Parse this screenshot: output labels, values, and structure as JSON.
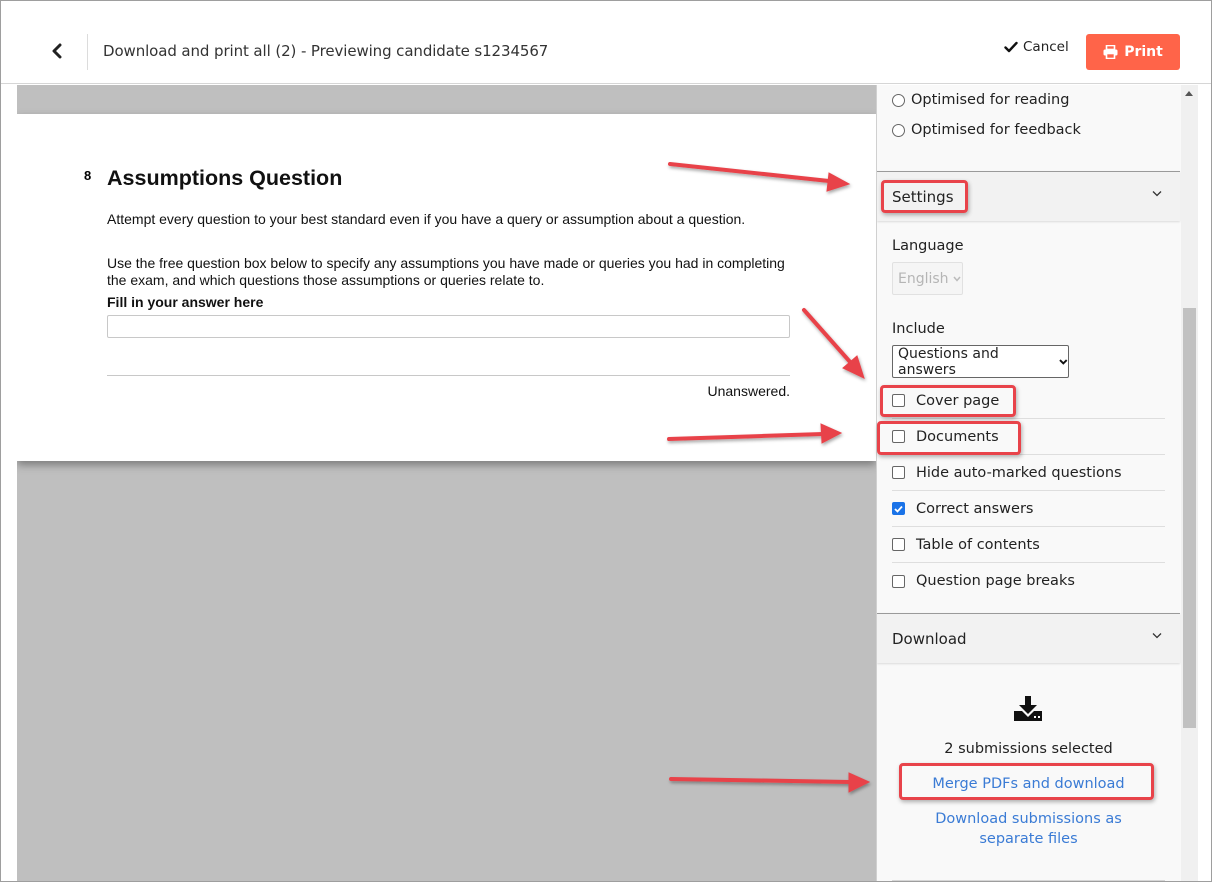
{
  "header": {
    "title": "Download and print all (2) - Previewing candidate s1234567",
    "back_icon": "chevron-left-icon",
    "cancel_label": "Cancel",
    "cancel_icon": "checkmark-icon",
    "print_label": "Print",
    "print_icon": "printer-icon",
    "print_color": "#ff6449"
  },
  "preview": {
    "question_number": "8",
    "question_title": "Assumptions Question",
    "paragraph_1": "Attempt every question to your best standard even if you have a query or assumption about a question.",
    "paragraph_2": "Use the free question box below to specify any assumptions you have made or queries you had in completing the exam, and which questions those assumptions or queries relate to.",
    "answer_label": "Fill in your answer here",
    "answer_value": "",
    "status": "Unanswered."
  },
  "sidebar": {
    "layout_options": [
      {
        "label": "Optimised for reading",
        "selected": false
      },
      {
        "label": "Optimised for feedback",
        "selected": false
      }
    ],
    "settings": {
      "header": "Settings",
      "language_label": "Language",
      "language_value": "English",
      "include_label": "Include",
      "include_value": "Questions and answers",
      "checkboxes": [
        {
          "label": "Cover page",
          "checked": false
        },
        {
          "label": "Documents",
          "checked": false
        },
        {
          "label": "Hide auto-marked questions",
          "checked": false
        },
        {
          "label": "Correct answers",
          "checked": true
        },
        {
          "label": "Table of contents",
          "checked": false
        },
        {
          "label": "Question page breaks",
          "checked": false
        }
      ]
    },
    "download": {
      "header": "Download",
      "icon": "download-icon",
      "count_text": "2 submissions selected",
      "merge_link": "Merge PDFs and download",
      "separate_link": "Download submissions as separate files"
    }
  },
  "colors": {
    "accent_link": "#3a7bd5",
    "checkbox_checked": "#1a73e8",
    "annotation": "#e8434a"
  }
}
